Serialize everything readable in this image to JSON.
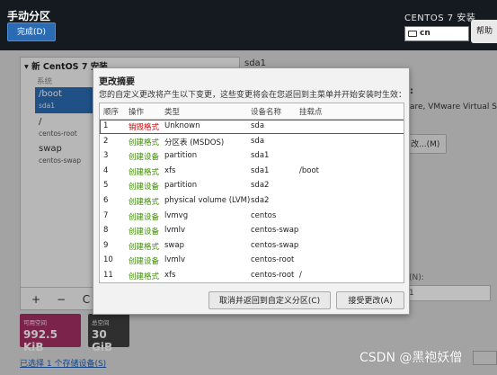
{
  "header": {
    "title": "手动分区",
    "done_label": "完成(D)",
    "os_title": "CENTOS 7 安装",
    "keyboard_layout": "cn",
    "help_label": "帮助"
  },
  "left_panel": {
    "title": "▾ 新 CentOS 7 安装",
    "section": "系统",
    "items": [
      {
        "mount": "/boot",
        "device": "sda1"
      },
      {
        "mount": "/",
        "device": "centos-root"
      },
      {
        "mount": "swap",
        "device": "centos-swap"
      }
    ],
    "tools": [
      "+",
      "−",
      "C"
    ]
  },
  "right_panel": {
    "device": "sda1",
    "colon": ":",
    "vm_text": "are, VMware Virtual S",
    "modify_label": "改...(M)",
    "n_label": "(N):",
    "field_value": "1"
  },
  "space": {
    "available_label": "可用空间",
    "available_value": "992.5 KiB",
    "total_label": "总空间",
    "total_value": "30 GiB"
  },
  "storage_link": "已选择 1 个存储设备(S)",
  "dialog": {
    "title": "更改摘要",
    "message": "您的自定义更改将产生以下变更，这些变更将会在您返回到主菜单并开始安装时生效：",
    "columns": [
      "顺序",
      "操作",
      "类型",
      "设备名称",
      "挂载点"
    ],
    "rows": [
      {
        "order": "1",
        "action": "销毁格式",
        "type": "Unknown",
        "device": "sda",
        "mount": ""
      },
      {
        "order": "2",
        "action": "创建格式",
        "type": "分区表 (MSDOS)",
        "device": "sda",
        "mount": ""
      },
      {
        "order": "3",
        "action": "创建设备",
        "type": "partition",
        "device": "sda1",
        "mount": ""
      },
      {
        "order": "4",
        "action": "创建格式",
        "type": "xfs",
        "device": "sda1",
        "mount": "/boot"
      },
      {
        "order": "5",
        "action": "创建设备",
        "type": "partition",
        "device": "sda2",
        "mount": ""
      },
      {
        "order": "6",
        "action": "创建格式",
        "type": "physical volume (LVM)",
        "device": "sda2",
        "mount": ""
      },
      {
        "order": "7",
        "action": "创建设备",
        "type": "lvmvg",
        "device": "centos",
        "mount": ""
      },
      {
        "order": "8",
        "action": "创建设备",
        "type": "lvmlv",
        "device": "centos-swap",
        "mount": ""
      },
      {
        "order": "9",
        "action": "创建格式",
        "type": "swap",
        "device": "centos-swap",
        "mount": ""
      },
      {
        "order": "10",
        "action": "创建设备",
        "type": "lvmlv",
        "device": "centos-root",
        "mount": ""
      },
      {
        "order": "11",
        "action": "创建格式",
        "type": "xfs",
        "device": "centos-root",
        "mount": "/"
      }
    ],
    "cancel_label": "取消并返回到自定义分区(C)",
    "accept_label": "接受更改(A)"
  },
  "colors": {
    "destroy": "#cc0000",
    "create": "#3a8a00",
    "accent": "#2a6bb3",
    "available_tile": "#a42f63"
  },
  "watermark": "CSDN @黑袍妖僧"
}
